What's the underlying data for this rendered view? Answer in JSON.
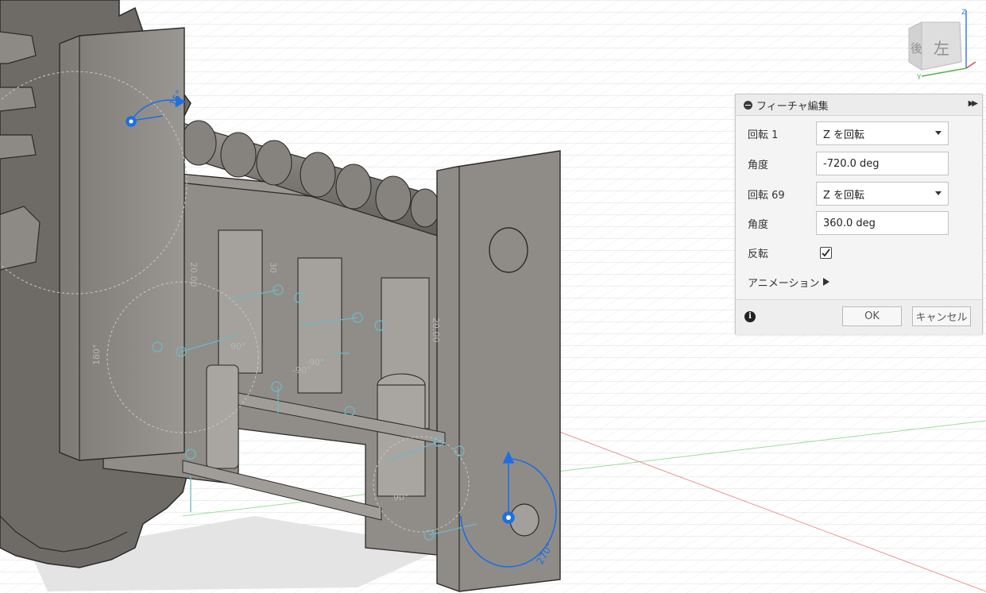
{
  "viewcube": {
    "face_left": "左",
    "face_back": "後",
    "axis_z": "Z",
    "axis_y": "Y"
  },
  "viewport": {
    "angle_label_top": "15°",
    "angle_label_bottom": "270°",
    "dim_labels": [
      "20.00",
      "20.00",
      "30",
      "-90°",
      "90°",
      "180°",
      "-90°",
      "90°"
    ]
  },
  "panel": {
    "title": "フィーチャ編集",
    "rows": [
      {
        "label": "回転 1",
        "value": "Z を回転"
      },
      {
        "label": "角度",
        "value": "-720.0 deg"
      },
      {
        "label": "回転 69",
        "value": "Z を回転"
      },
      {
        "label": "角度",
        "value": "360.0 deg"
      }
    ],
    "reverse_label": "反転",
    "reverse_checked": true,
    "animation_label": "アニメーション",
    "ok_label": "OK",
    "cancel_label": "キャンセル"
  },
  "colors": {
    "part": "#8a8782",
    "part_dark": "#6f6c68",
    "manipulator": "#1f6fe0",
    "grid": "#dcdcdc"
  }
}
